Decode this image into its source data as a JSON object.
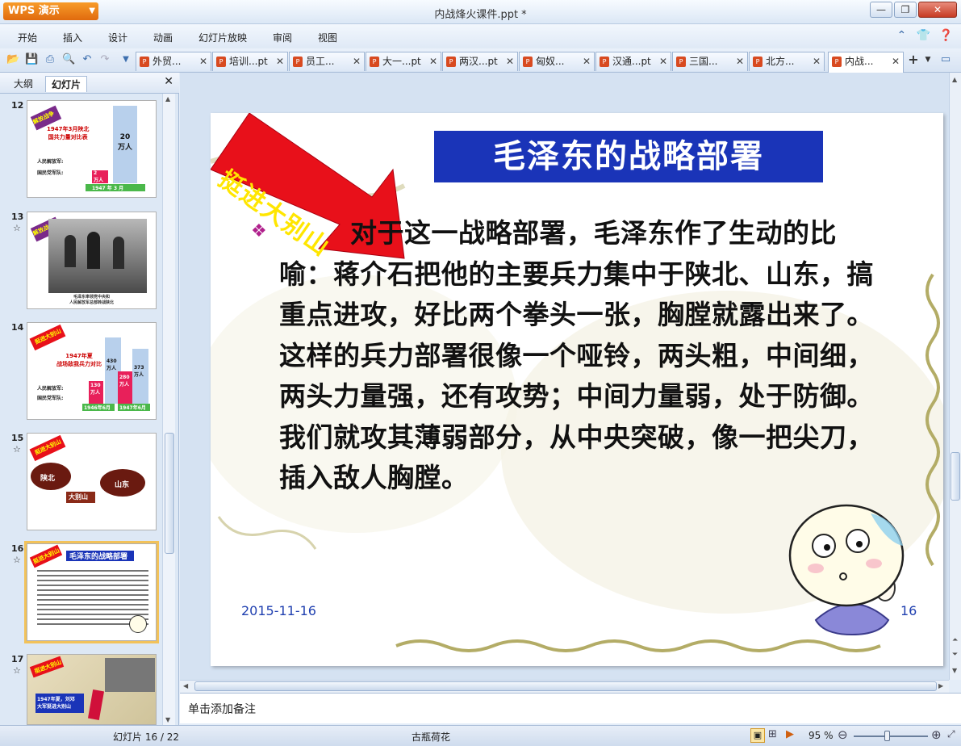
{
  "app": {
    "name": "WPS 演示",
    "window_title": "内战烽火课件.ppt *"
  },
  "window_buttons": {
    "minimize": "—",
    "restore": "❐",
    "close": "✕"
  },
  "menu": [
    "开始",
    "插入",
    "设计",
    "动画",
    "幻灯片放映",
    "审阅",
    "视图"
  ],
  "tabs": [
    {
      "label": "外贸..."
    },
    {
      "label": "培训...pt"
    },
    {
      "label": "员工..."
    },
    {
      "label": "大一...pt"
    },
    {
      "label": "两汉...pt"
    },
    {
      "label": "匈奴..."
    },
    {
      "label": "汉通...pt"
    },
    {
      "label": "三国..."
    },
    {
      "label": "北方..."
    },
    {
      "label": "内战..."
    }
  ],
  "left_panel": {
    "tabs": [
      "大纲",
      "幻灯片"
    ],
    "slides": [
      {
        "num": "12",
        "badge": "解放战争",
        "title": "1947年3月陕北\n国共力量对比表",
        "big": "20\n万人",
        "small": "2\n万人",
        "row1": "人民解放军:",
        "row2": "国民党军队:",
        "footer": "1947 年 3 月"
      },
      {
        "num": "13",
        "badge": "解放战争",
        "caption": "毛泽东率领党中央和\n人民解放军总部转战陕北"
      },
      {
        "num": "14",
        "badge": "挺进大别山",
        "title": "1947年夏\n战场敌我兵力对比",
        "v1": "430\n万人",
        "v2": "373\n万人",
        "v3": "130\n万人",
        "v4": "280\n万人",
        "row1": "人民解放军:",
        "row2": "国民党军队:",
        "footer1": "1946年6月",
        "footer2": "1947年6月"
      },
      {
        "num": "15",
        "badge": "挺进大别山",
        "shaanbei": "陕北",
        "shandong": "山东",
        "dabieshan": "大别山"
      },
      {
        "num": "16",
        "badge": "挺进大别山",
        "title": "毛泽东的战略部署"
      },
      {
        "num": "17",
        "badge": "挺进大别山",
        "caption": "1947年夏，刘邓\n大军挺进大别山"
      }
    ]
  },
  "slide": {
    "banner": "挺进大别山",
    "title": "毛泽东的战略部署",
    "bullet": "❖",
    "body": "对于这一战略部署，毛泽东作了生动的比喻：蒋介石把他的主要兵力集中于陕北、山东，搞重点进攻，好比两个拳头一张，胸膛就露出来了。这样的兵力部署很像一个哑铃，两头粗，中间细，两头力量强，还有攻势；中间力量弱，处于防御。我们就攻其薄弱部分，从中央突破，像一把尖刀，插入敌人胸膛。",
    "date": "2015-11-16",
    "number": "16"
  },
  "notes_placeholder": "单击添加备注",
  "status": {
    "slide_counter": "幻灯片 16 / 22",
    "theme": "古瓶荷花",
    "zoom": "95 %"
  },
  "colors": {
    "title_bg": "#1a34b8",
    "banner_red": "#e8101a",
    "accent_orange": "#f08a1c"
  }
}
